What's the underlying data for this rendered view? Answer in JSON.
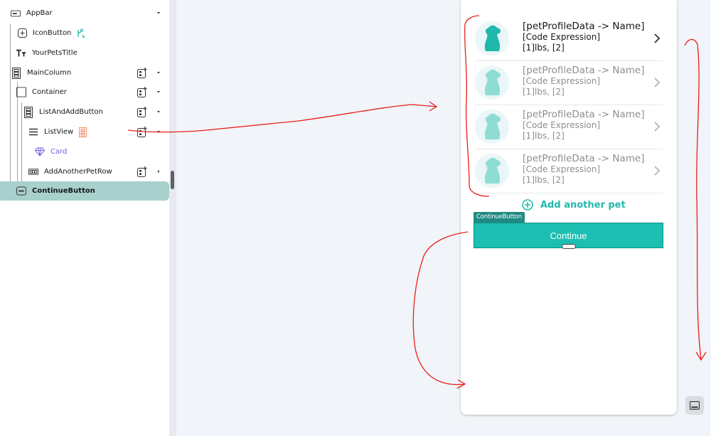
{
  "tree": {
    "nodes": [
      {
        "id": "appbar",
        "label": "AppBar"
      },
      {
        "id": "iconbutton",
        "label": "IconButton"
      },
      {
        "id": "title",
        "label": "YourPetsTitle"
      },
      {
        "id": "maincolumn",
        "label": "MainColumn"
      },
      {
        "id": "container",
        "label": "Container"
      },
      {
        "id": "listandadd",
        "label": "ListAndAddButton"
      },
      {
        "id": "listview",
        "label": "ListView"
      },
      {
        "id": "card",
        "label": "Card"
      },
      {
        "id": "addrow",
        "label": "AddAnotherPetRow"
      },
      {
        "id": "continue",
        "label": "ContinueButton"
      }
    ],
    "colors": {
      "accent": "#20b8ac",
      "component": "#7b5ce0",
      "warning": "#f0926c",
      "selected": "#a8d0cc"
    }
  },
  "preview": {
    "pets": [
      {
        "name": "[petProfileData -> Name]",
        "code": "[Code Expression]",
        "weight": "[1]lbs, [2]",
        "dimmed": false
      },
      {
        "name": "[petProfileData -> Name]",
        "code": "[Code Expression]",
        "weight": "[1]lbs, [2]",
        "dimmed": true
      },
      {
        "name": "[petProfileData -> Name]",
        "code": "[Code Expression]",
        "weight": "[1]lbs, [2]",
        "dimmed": true
      },
      {
        "name": "[petProfileData -> Name]",
        "code": "[Code Expression]",
        "weight": "[1]lbs, [2]",
        "dimmed": true
      }
    ],
    "add_another_label": "Add another pet",
    "continue_tag": "ContinueButton",
    "continue_label": "Continue",
    "colors": {
      "primary": "#1cbfb2",
      "pet_icon": "#1fb8ab",
      "pet_icon_dim": "#8fdcd5"
    }
  },
  "icons": {
    "appbar": "appbar-icon",
    "iconbutton": "add-box-icon",
    "branch": "branch-icon",
    "title": "text-icon",
    "column": "column-icon",
    "container": "square-icon",
    "listview": "list-icon",
    "card": "diamond-icon",
    "row": "row-icon",
    "button": "button-icon",
    "pet": "dog-icon",
    "chevron": "chevron-right-icon",
    "add": "add-circle-icon",
    "device": "device-icon"
  },
  "annotation_color": "#e8201a"
}
